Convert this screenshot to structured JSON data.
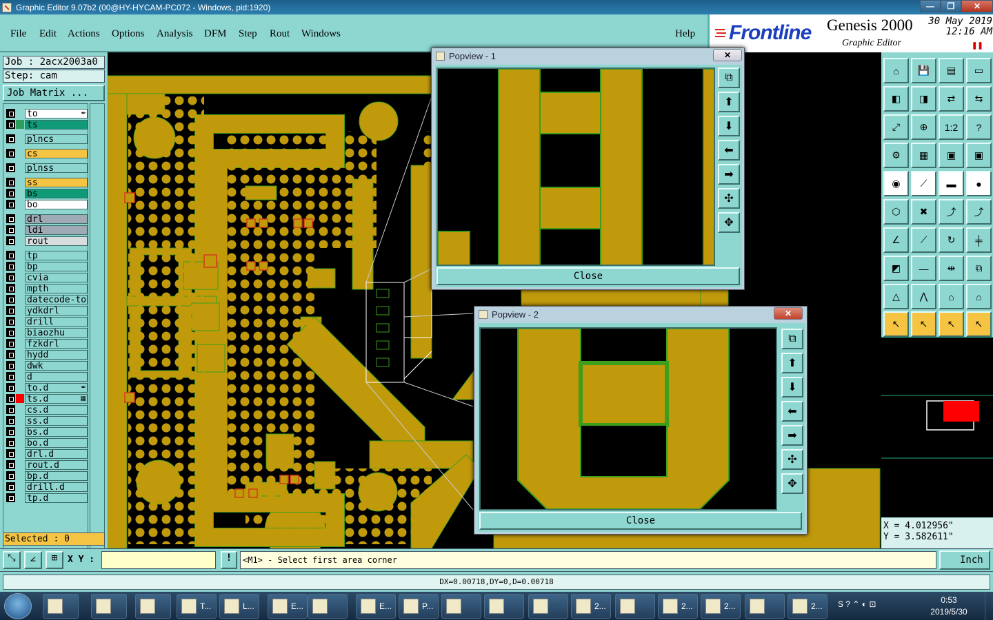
{
  "window": {
    "title": "Graphic Editor 9.07b2 (00@HY-HYCAM-PC072 - Windows, pid:1920)"
  },
  "menu": {
    "items": [
      "File",
      "Edit",
      "Actions",
      "Options",
      "Analysis",
      "DFM",
      "Step",
      "Rout",
      "Windows"
    ],
    "help": "Help"
  },
  "brand": {
    "company": "Frontline",
    "product": "Genesis 2000",
    "subtitle": "Graphic Editor",
    "date": "30 May 2019",
    "time": "12:16 AM"
  },
  "job": {
    "job_label": "Job : 2acx2003a0",
    "step_label": "Step: cam",
    "matrix_button": "Job Matrix ..."
  },
  "layers": [
    {
      "name": "to",
      "swatch": "#8ed6d0",
      "bg": "#ffffff",
      "mark": "feather"
    },
    {
      "name": "ts",
      "swatch": "#2e9e5c",
      "bg": "#0f9b78",
      "mark": ""
    },
    {
      "name": "plncs",
      "swatch": "#8ed6d0",
      "bg": "#8ed6d0",
      "mark": ""
    },
    {
      "name": "cs",
      "swatch": "#8ed6d0",
      "bg": "#f5c443",
      "mark": ""
    },
    {
      "name": "plnss",
      "swatch": "#8ed6d0",
      "bg": "#8ed6d0",
      "mark": ""
    },
    {
      "name": "ss",
      "swatch": "#8ed6d0",
      "bg": "#f5c443",
      "mark": ""
    },
    {
      "name": "bs",
      "swatch": "#8ed6d0",
      "bg": "#0f9b78",
      "mark": ""
    },
    {
      "name": "bo",
      "swatch": "#8ed6d0",
      "bg": "#ffffff",
      "mark": ""
    },
    {
      "name": "drl",
      "swatch": "#8ed6d0",
      "bg": "#a0aab4",
      "mark": ""
    },
    {
      "name": "ldi",
      "swatch": "#8ed6d0",
      "bg": "#a0aab4",
      "mark": ""
    },
    {
      "name": "rout",
      "swatch": "#8ed6d0",
      "bg": "#d8dde0",
      "mark": ""
    },
    {
      "name": "tp",
      "swatch": "#8ed6d0",
      "bg": "#8ed6d0",
      "mark": ""
    },
    {
      "name": "bp",
      "swatch": "#8ed6d0",
      "bg": "#8ed6d0",
      "mark": ""
    },
    {
      "name": "cvia",
      "swatch": "#8ed6d0",
      "bg": "#8ed6d0",
      "mark": ""
    },
    {
      "name": "mpth",
      "swatch": "#8ed6d0",
      "bg": "#8ed6d0",
      "mark": ""
    },
    {
      "name": "datecode-to",
      "swatch": "#8ed6d0",
      "bg": "#8ed6d0",
      "mark": ""
    },
    {
      "name": "ydkdrl",
      "swatch": "#8ed6d0",
      "bg": "#8ed6d0",
      "mark": ""
    },
    {
      "name": "drill",
      "swatch": "#8ed6d0",
      "bg": "#8ed6d0",
      "mark": ""
    },
    {
      "name": "biaozhu",
      "swatch": "#8ed6d0",
      "bg": "#8ed6d0",
      "mark": ""
    },
    {
      "name": "fzkdrl",
      "swatch": "#8ed6d0",
      "bg": "#8ed6d0",
      "mark": ""
    },
    {
      "name": "hydd",
      "swatch": "#8ed6d0",
      "bg": "#8ed6d0",
      "mark": ""
    },
    {
      "name": "dwk",
      "swatch": "#8ed6d0",
      "bg": "#8ed6d0",
      "mark": ""
    },
    {
      "name": "d",
      "swatch": "#8ed6d0",
      "bg": "#8ed6d0",
      "mark": ""
    },
    {
      "name": "to.d",
      "swatch": "#8ed6d0",
      "bg": "#8ed6d0",
      "mark": "feather"
    },
    {
      "name": "ts.d",
      "swatch": "#ff0000",
      "bg": "#8ed6d0",
      "mark": "grid"
    },
    {
      "name": "cs.d",
      "swatch": "#8ed6d0",
      "bg": "#8ed6d0",
      "mark": ""
    },
    {
      "name": "ss.d",
      "swatch": "#8ed6d0",
      "bg": "#8ed6d0",
      "mark": ""
    },
    {
      "name": "bs.d",
      "swatch": "#8ed6d0",
      "bg": "#8ed6d0",
      "mark": ""
    },
    {
      "name": "bo.d",
      "swatch": "#8ed6d0",
      "bg": "#8ed6d0",
      "mark": ""
    },
    {
      "name": "drl.d",
      "swatch": "#8ed6d0",
      "bg": "#8ed6d0",
      "mark": ""
    },
    {
      "name": "rout.d",
      "swatch": "#8ed6d0",
      "bg": "#8ed6d0",
      "mark": ""
    },
    {
      "name": "bp.d",
      "swatch": "#8ed6d0",
      "bg": "#8ed6d0",
      "mark": ""
    },
    {
      "name": "drill.d",
      "swatch": "#8ed6d0",
      "bg": "#8ed6d0",
      "mark": ""
    },
    {
      "name": "tp.d",
      "swatch": "#8ed6d0",
      "bg": "#8ed6d0",
      "mark": ""
    }
  ],
  "selected": "Selected : 0",
  "cursor": {
    "x": "X = 4.012956\"",
    "y": "Y = 3.582611\""
  },
  "command": {
    "xy_label": "X Y :",
    "xy_value": "",
    "prompt": "<M1> - Select first area corner",
    "units": "Inch"
  },
  "status": "DX=0.00718,DY=0,D=0.00718",
  "popview1": {
    "title": "Popview - 1",
    "close_label": "Close"
  },
  "popview2": {
    "title": "Popview - 2",
    "close_label": "Close"
  },
  "taskbar": {
    "buttons": [
      "T...",
      "L...",
      "E...",
      "",
      "E...",
      "P...",
      "",
      "",
      "",
      "2...",
      "",
      "2...",
      "2...",
      "",
      "2..."
    ],
    "time": "0:53",
    "date": "2019/5/30"
  },
  "colors": {
    "copper": "#c19a0c",
    "panel": "#8ed6d0",
    "outline": "#3c9e1a",
    "pad_edge": "#d23c1a"
  }
}
